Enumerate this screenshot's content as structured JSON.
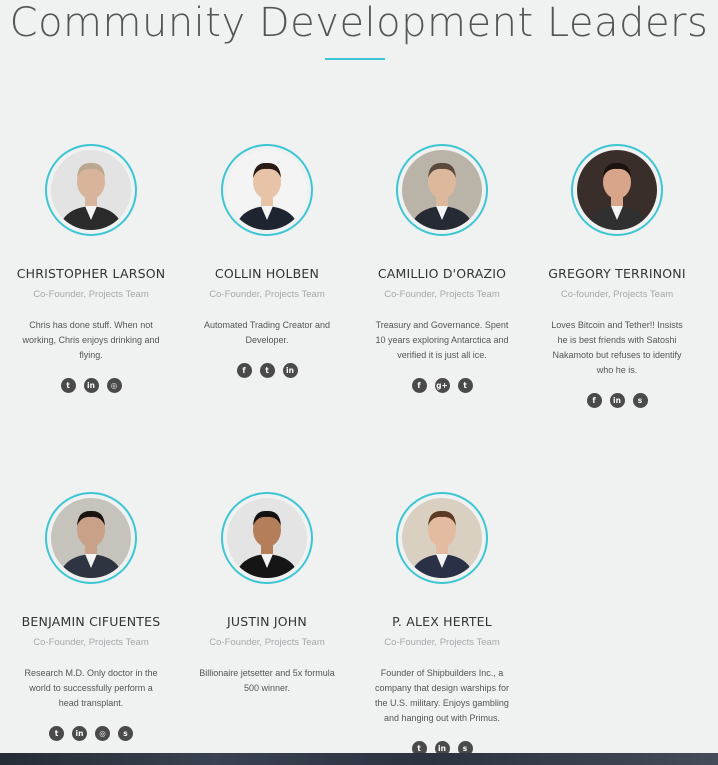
{
  "section_title": "Community Development Leaders",
  "members": [
    {
      "name": "CHRISTOPHER LARSON",
      "role": "Co-Founder, Projects Team",
      "bio": "Chris has done stuff. When not working, Chris enjoys drinking and flying.",
      "socials": [
        {
          "icon": "twitter-icon",
          "glyph": "t"
        },
        {
          "icon": "linkedin-icon",
          "glyph": "in"
        },
        {
          "icon": "instagram-icon",
          "glyph": "◎"
        }
      ]
    },
    {
      "name": "COLLIN HOLBEN",
      "role": "Co-Founder, Projects Team",
      "bio": "Automated Trading Creator and Developer.",
      "socials": [
        {
          "icon": "facebook-icon",
          "glyph": "f"
        },
        {
          "icon": "twitter-icon",
          "glyph": "t"
        },
        {
          "icon": "linkedin-icon",
          "glyph": "in"
        }
      ]
    },
    {
      "name": "CAMILLIO D'ORAZIO",
      "role": "Co-Founder, Projects Team",
      "bio": "Treasury and Governance. Spent 10 years exploring Antarctica and verified it is just all ice.",
      "socials": [
        {
          "icon": "facebook-icon",
          "glyph": "f"
        },
        {
          "icon": "google-plus-icon",
          "glyph": "g+"
        },
        {
          "icon": "twitter-icon",
          "glyph": "t"
        }
      ]
    },
    {
      "name": "GREGORY TERRINONI",
      "role": "Co-founder, Projects Team",
      "bio": "Loves Bitcoin and Tether!! Insists he is best friends with Satoshi Nakamoto but refuses to identify who he is.",
      "socials": [
        {
          "icon": "facebook-icon",
          "glyph": "f"
        },
        {
          "icon": "linkedin-icon",
          "glyph": "in"
        },
        {
          "icon": "skype-icon",
          "glyph": "s"
        }
      ]
    },
    {
      "name": "BENJAMIN CIFUENTES",
      "role": "Co-Founder, Projects Team",
      "bio": "Research M.D. Only doctor in the world to successfully perform a head transplant.",
      "socials": [
        {
          "icon": "twitter-icon",
          "glyph": "t"
        },
        {
          "icon": "linkedin-icon",
          "glyph": "in"
        },
        {
          "icon": "instagram-icon",
          "glyph": "◎"
        },
        {
          "icon": "skype-icon",
          "glyph": "s"
        }
      ]
    },
    {
      "name": "JUSTIN JOHN",
      "role": "Co-Founder, Projects Team",
      "bio": "Billionaire jetsetter and 5x formula 500 winner.",
      "socials": []
    },
    {
      "name": "P. ALEX HERTEL",
      "role": "Co-Founder, Projects Team",
      "bio": "Founder of Shipbuilders Inc., a company that design warships for the U.S. military. Enjoys gambling and hanging out with Primus.",
      "socials": [
        {
          "icon": "twitter-icon",
          "glyph": "t"
        },
        {
          "icon": "linkedin-icon",
          "glyph": "in"
        },
        {
          "icon": "skype-icon",
          "glyph": "s"
        }
      ]
    }
  ],
  "colors": {
    "accent": "#3cc6d3",
    "background": "#f0f1f1",
    "social_bg": "#4a4a4a",
    "role_text": "#a5a9ab"
  }
}
